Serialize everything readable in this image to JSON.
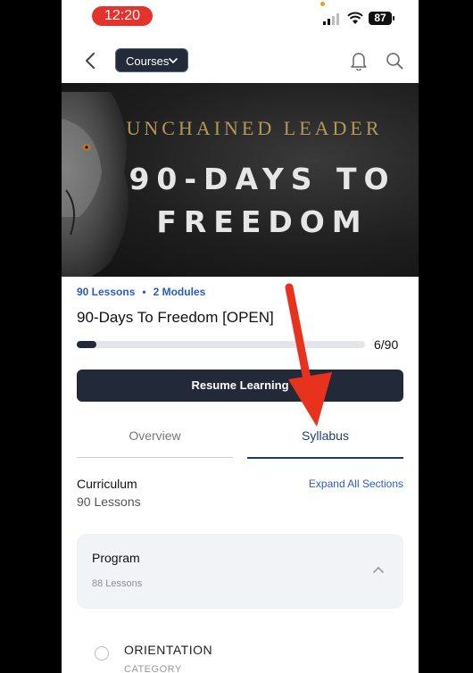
{
  "status_bar": {
    "time": "12:20",
    "battery": "87"
  },
  "nav": {
    "courses_label": "Courses"
  },
  "hero": {
    "subtitle": "UNCHAINED LEADER",
    "title_line1": "90-DAYS TO",
    "title_line2": "FREEDOM"
  },
  "course": {
    "lessons_count": "90 Lessons",
    "modules_count": "2 Modules",
    "title": "90-Days To Freedom [OPEN]",
    "progress_value": 6,
    "progress_total": 90,
    "progress_text": "6/90",
    "resume_label": "Resume Learning"
  },
  "tabs": [
    {
      "label": "Overview",
      "active": false
    },
    {
      "label": "Syllabus",
      "active": true
    }
  ],
  "curriculum": {
    "label": "Curriculum",
    "count": "90 Lessons",
    "expand_label": "Expand All Sections"
  },
  "section": {
    "title": "Program",
    "count": "88 Lessons"
  },
  "lesson": {
    "title": "ORIENTATION",
    "category": "CATEGORY"
  },
  "colors": {
    "accent": "#222a3a",
    "link": "#2b5bc2",
    "arrow": "#e8321e",
    "time_pill": "#e5322d"
  },
  "icons": [
    "back-chevron-icon",
    "chevron-down-icon",
    "bell-icon",
    "search-icon",
    "chevron-up-icon",
    "signal-icon",
    "wifi-icon"
  ]
}
